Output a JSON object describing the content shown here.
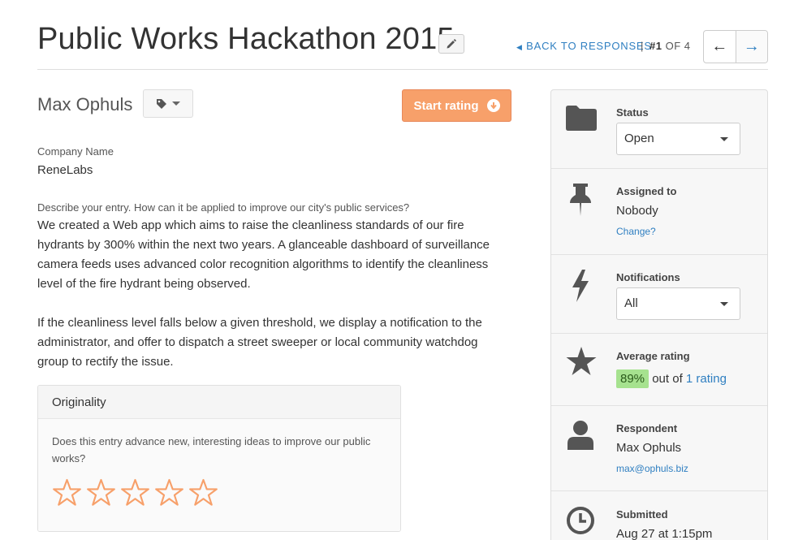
{
  "header": {
    "title": "Public Works Hackathon 2015",
    "back_label": "BACK TO RESPONSES",
    "pager_sep": "|",
    "pager_current": "#1",
    "pager_of": "OF 4",
    "prev_glyph": "←",
    "next_glyph": "→"
  },
  "response": {
    "respondent_name": "Max Ophuls",
    "start_rating_label": "Start rating",
    "company_label": "Company Name",
    "company_value": "ReneLabs",
    "question_label": "Describe your entry. How can it be applied to improve our city's public services?",
    "answer_p1": "We created a Web app which aims to raise the cleanliness standards of our fire hydrants by 300% within the next two years. A glanceable dashboard of surveillance camera feeds uses advanced color recognition algorithms to identify the cleanliness level of the fire hydrant being observed.",
    "answer_p2": "If the cleanliness level falls below a given threshold, we display a notification to the administrator, and offer to dispatch a street sweeper or local community watchdog group to rectify the issue."
  },
  "criterion": {
    "title": "Originality",
    "question": "Does this entry advance new, interesting ideas to improve our public works?",
    "stars_max": 5,
    "stars_filled": 0
  },
  "sidebar": {
    "status": {
      "label": "Status",
      "value": "Open"
    },
    "assigned": {
      "label": "Assigned to",
      "value": "Nobody",
      "change_label": "Change?"
    },
    "notifications": {
      "label": "Notifications",
      "value": "All"
    },
    "rating": {
      "label": "Average rating",
      "percent": "89%",
      "out_of": "out of",
      "count_label": "1 rating"
    },
    "respondent": {
      "label": "Respondent",
      "name": "Max Ophuls",
      "email": "max@ophuls.biz"
    },
    "submitted": {
      "label": "Submitted",
      "value": "Aug 27 at 1:15pm"
    }
  },
  "colors": {
    "accent_orange": "#f7a06a",
    "link_blue": "#2f7fc1",
    "rating_green": "#a6e28f",
    "icon_gray": "#555555"
  },
  "icons": [
    "pencil-icon",
    "chevron-left-icon",
    "tag-icon",
    "circle-arrow-down-icon",
    "folder-icon",
    "pushpin-icon",
    "lightning-icon",
    "star-icon",
    "user-icon",
    "clock-icon"
  ]
}
